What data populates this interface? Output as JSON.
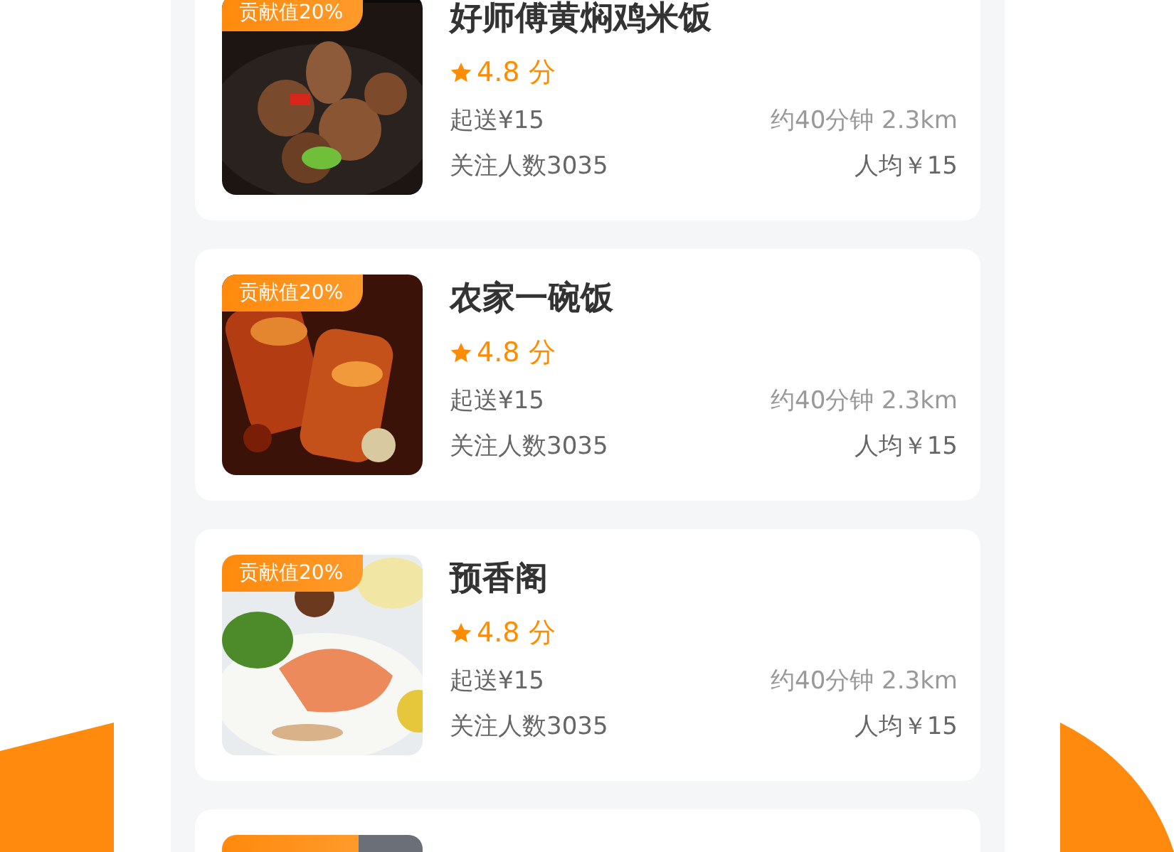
{
  "shops": [
    {
      "kind": "full",
      "badge": "贡献值20%",
      "name": "好师傅黄焖鸡米饭",
      "rating": "4.8 分",
      "min_order": "起送¥15",
      "delivery": "约40分钟 2.3km",
      "followers": "关注人数3035",
      "per_capita": "人均￥15"
    },
    {
      "kind": "full",
      "badge": "贡献值20%",
      "name": "农家一碗饭",
      "rating": "4.8 分",
      "min_order": "起送¥15",
      "delivery": "约40分钟 2.3km",
      "followers": "关注人数3035",
      "per_capita": "人均￥15"
    },
    {
      "kind": "full",
      "badge": "贡献值20%",
      "name": "预香阁",
      "rating": "4.8 分",
      "min_order": "起送¥15",
      "delivery": "约40分钟 2.3km",
      "followers": "关注人数3035",
      "per_capita": "人均￥15"
    },
    {
      "kind": "partial"
    }
  ]
}
